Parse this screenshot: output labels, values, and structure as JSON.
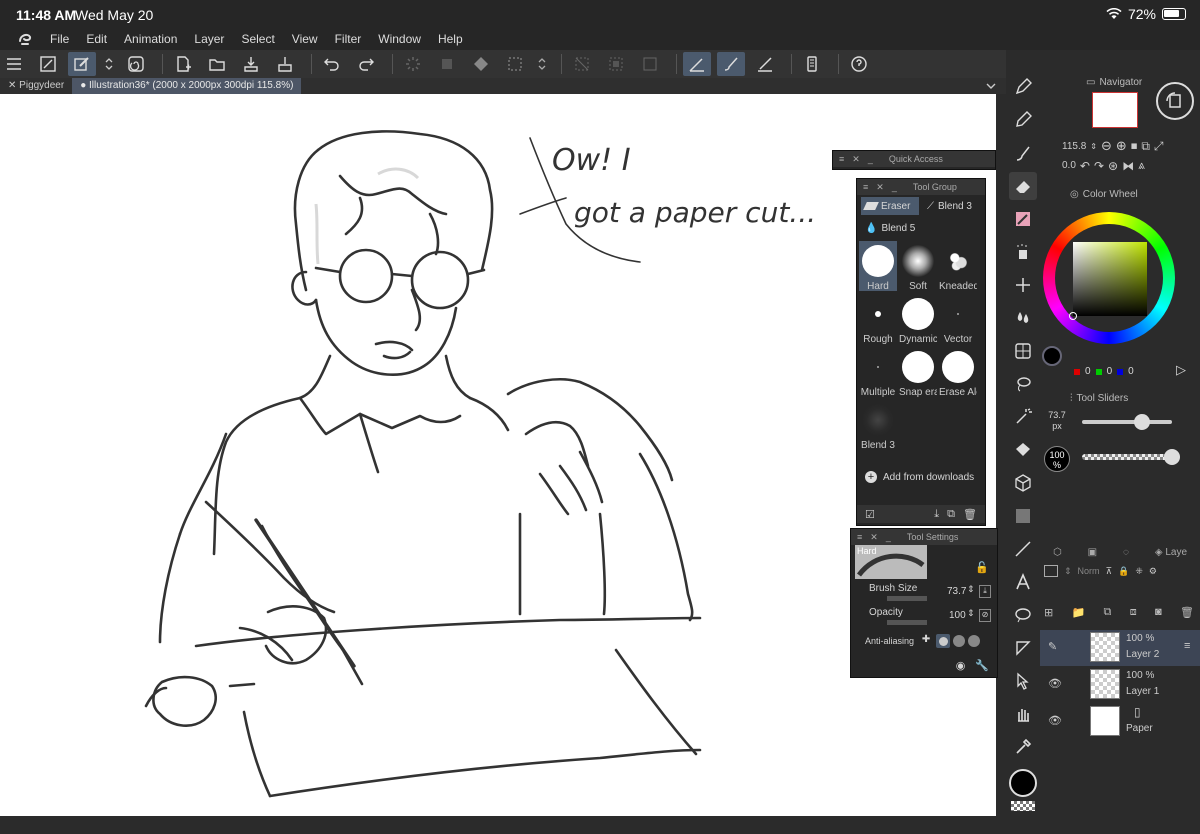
{
  "status": {
    "time": "11:48 AM",
    "date": "Wed May 20",
    "battery": "72%"
  },
  "menu": [
    "File",
    "Edit",
    "Animation",
    "Layer",
    "Select",
    "View",
    "Filter",
    "Window",
    "Help"
  ],
  "tabs": [
    {
      "label": "Piggydeer",
      "active": false
    },
    {
      "label": "Illustration36* (2000 x 2000px 300dpi 115.8%)",
      "active": true
    }
  ],
  "canvas": {
    "speech_line1": "Ow! I",
    "speech_line2": "got a paper cut..."
  },
  "navigator": {
    "title": "Navigator",
    "zoom": "115.8",
    "angle": "0.0"
  },
  "color_wheel": {
    "title": "Color Wheel",
    "r": "0",
    "g": "0",
    "b": "0"
  },
  "tool_sliders": {
    "title": "Tool Sliders",
    "size": "73.7 px",
    "opacity": "100 %"
  },
  "quick_access": {
    "title": "Quick Access"
  },
  "tool_group": {
    "title": "Tool Group",
    "subtools": [
      "Eraser",
      "Blend 3",
      "Blend 5"
    ],
    "brushes": [
      {
        "label": "Hard",
        "shape": "big"
      },
      {
        "label": "Soft",
        "shape": "soft"
      },
      {
        "label": "Kneaded",
        "shape": "kneaded"
      },
      {
        "label": "Rough",
        "shape": "dot"
      },
      {
        "label": "Dynamic",
        "shape": "big"
      },
      {
        "label": "Vector",
        "shape": "tiny"
      },
      {
        "label": "Multiple",
        "shape": "tiny"
      },
      {
        "label": "Snap era",
        "shape": "big"
      },
      {
        "label": "Erase Alc",
        "shape": "big"
      },
      {
        "label": "Blend 3",
        "shape": "dim"
      }
    ],
    "add_label": "Add from downloads"
  },
  "tool_settings": {
    "title": "Tool Settings",
    "preset": "Hard",
    "brush_size_label": "Brush Size",
    "brush_size": "73.7",
    "opacity_label": "Opacity",
    "opacity": "100",
    "aa_label": "Anti-aliasing"
  },
  "layers": {
    "blend": "Norm",
    "panel_title": "Laye",
    "rows": [
      {
        "pct": "100 %",
        "name": "Layer 2",
        "selected": true
      },
      {
        "pct": "100 %",
        "name": "Layer 1",
        "selected": false
      },
      {
        "pct": "",
        "name": "Paper",
        "selected": false
      }
    ]
  },
  "colors": {
    "accent": "#4d5666",
    "canvas": "#ffffff",
    "bg": "#2b2b2b"
  }
}
